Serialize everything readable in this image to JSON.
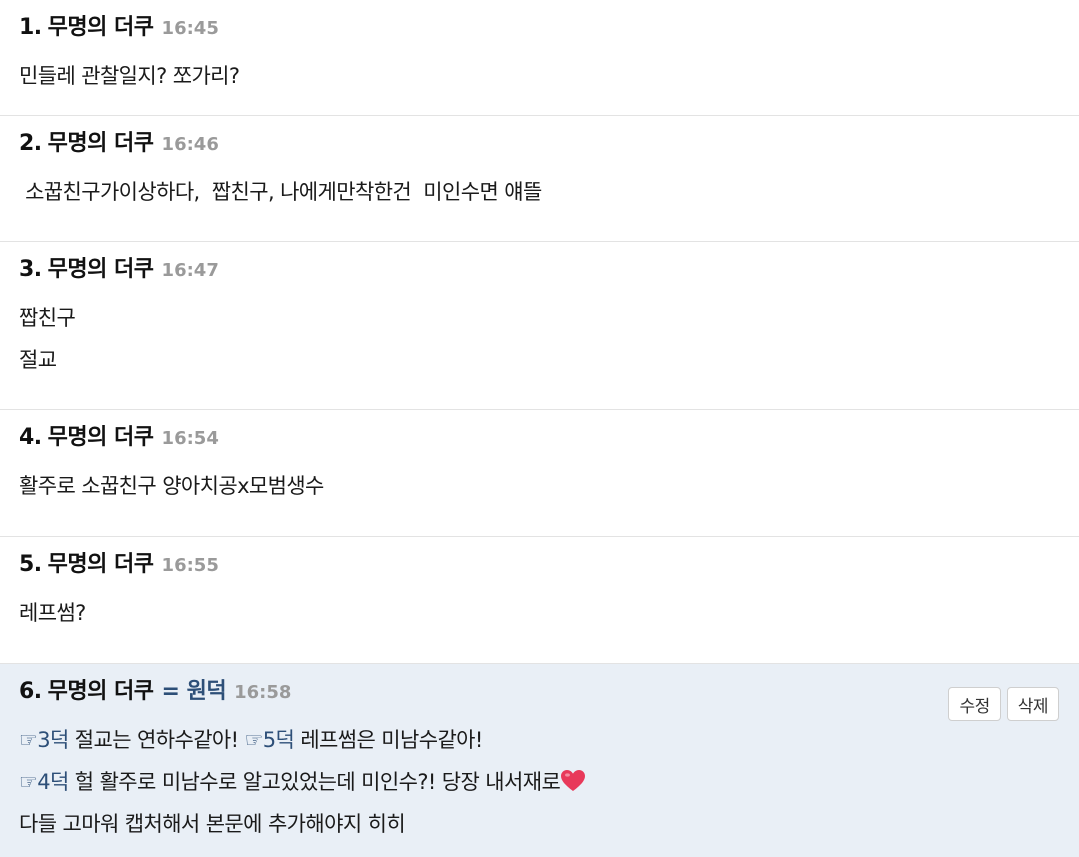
{
  "comments": [
    {
      "number": "1.",
      "author": "무명의 더쿠",
      "time": "16:45",
      "lines": [
        "민들레 관찰일지? 쪼가리?"
      ]
    },
    {
      "number": "2.",
      "author": "무명의 더쿠",
      "time": "16:46",
      "lines": [
        " 소꿉친구가이상하다,  짭친구, 나에게만착한건  미인수면 얘뜰"
      ]
    },
    {
      "number": "3.",
      "author": "무명의 더쿠",
      "time": "16:47",
      "lines": [
        "짭친구",
        "절교"
      ]
    },
    {
      "number": "4.",
      "author": "무명의 더쿠",
      "time": "16:54",
      "lines": [
        "활주로 소꿉친구 양아치공x모범생수"
      ]
    },
    {
      "number": "5.",
      "author": "무명의 더쿠",
      "time": "16:55",
      "lines": [
        "레프썸?"
      ]
    },
    {
      "number": "6.",
      "author": "무명의 더쿠",
      "op_tag": "= 원덕",
      "time": "16:58",
      "edit_label": "수정",
      "delete_label": "삭제",
      "line1_ref1": "☞3덕",
      "line1_text1": " 절교는 연하수같아! ",
      "line1_ref2": "☞5덕",
      "line1_text2": " 레프썸은 미남수같아!",
      "line2_ref": "☞4덕",
      "line2_text": " 헐 활주로 미남수로 알고있었는데 미인수?! 당장 내서재로",
      "line3_text": "다들 고마워 캡처해서 본문에 추가해야지 히히",
      "accent_color": "#2d4f78",
      "background_color": "#e9eff6",
      "heart_color": "#e8395a",
      "heart_icon": "heart-icon"
    }
  ]
}
